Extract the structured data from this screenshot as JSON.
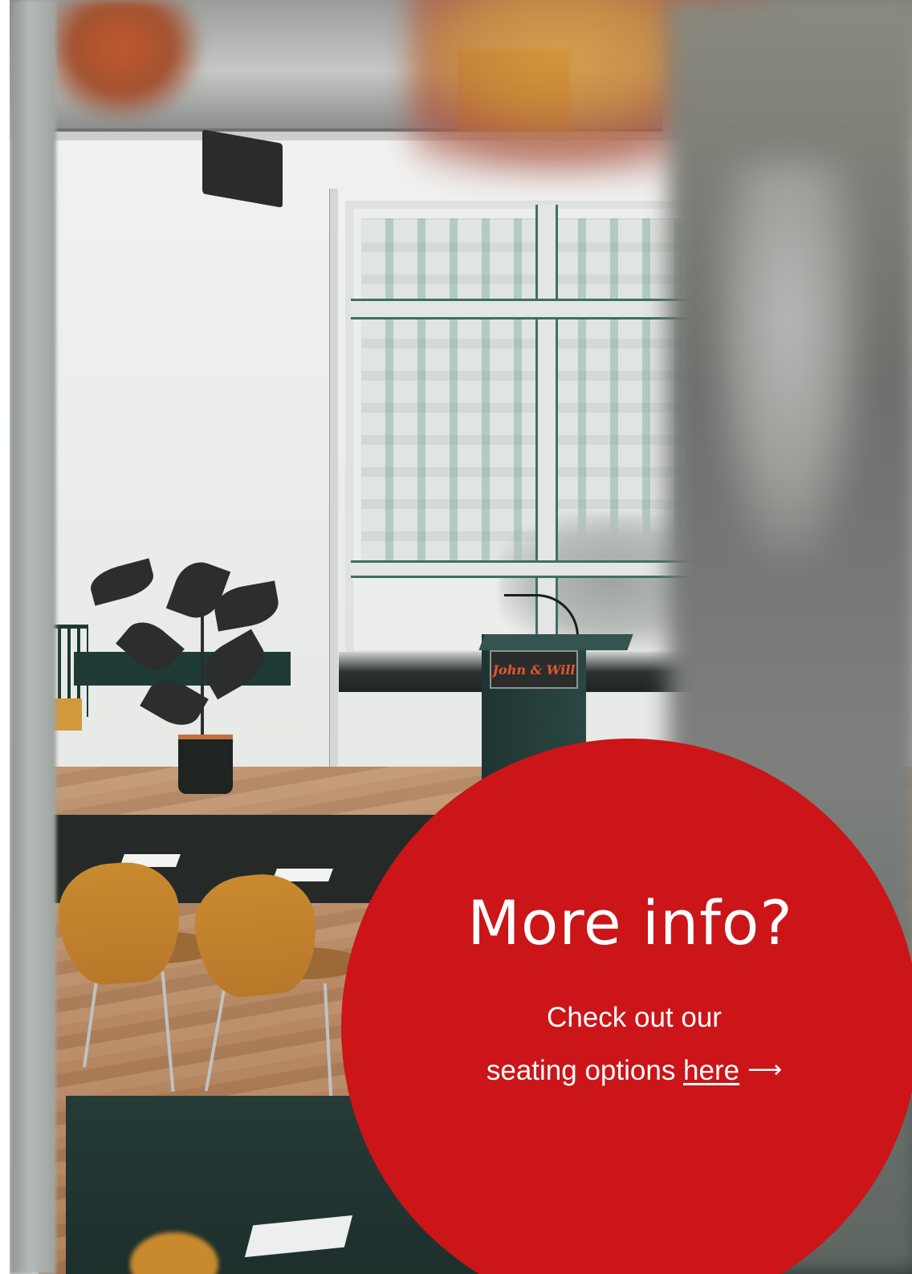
{
  "photo": {
    "description_icon": "event-room-photo",
    "lectern_sign": "John & Will"
  },
  "info": {
    "title": "More info?",
    "line1": "Check out our",
    "line2_prefix": "seating options ",
    "link_text": "here",
    "arrow_icon": "arrow-right-icon",
    "arrow_glyph": "⟶"
  },
  "colors": {
    "accent_red": "#cb1518",
    "text": "#ffffff"
  }
}
